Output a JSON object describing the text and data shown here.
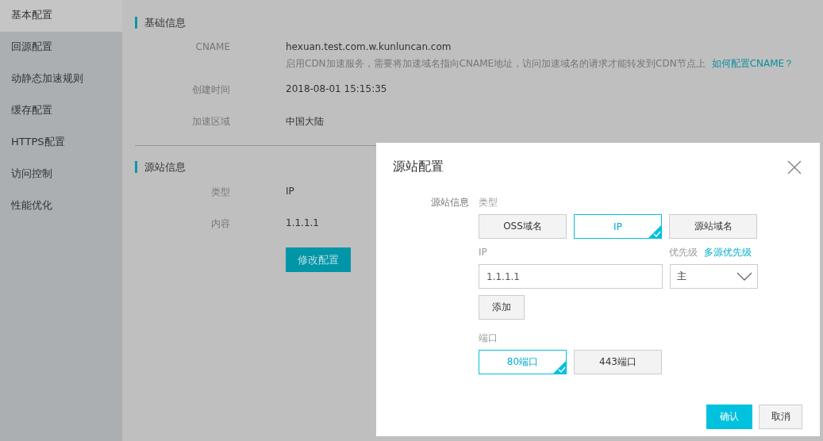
{
  "sidebar": {
    "items": [
      {
        "label": "基本配置",
        "selected": true
      },
      {
        "label": "回源配置",
        "selected": false
      },
      {
        "label": "动静态加速规则",
        "selected": false
      },
      {
        "label": "缓存配置",
        "selected": false
      },
      {
        "label": "HTTPS配置",
        "selected": false
      },
      {
        "label": "访问控制",
        "selected": false
      },
      {
        "label": "性能优化",
        "selected": false
      }
    ]
  },
  "basic_info": {
    "title": "基础信息",
    "fields": [
      {
        "label": "CNAME",
        "value": "hexuan.test.com.w.kunluncan.com",
        "hint": "启用CDN加速服务，需要将加速域名指向CNAME地址，访问加速域名的请求才能转发到CDN节点上",
        "link": "如何配置CNAME？"
      },
      {
        "label": "创建时间",
        "value": "2018-08-01 15:15:35"
      },
      {
        "label": "加速区域",
        "value": "中国大陆"
      }
    ]
  },
  "origin_info": {
    "title": "源站信息",
    "fields": [
      {
        "label": "类型",
        "value": "IP"
      },
      {
        "label": "内容",
        "value": "1.1.1.1"
      }
    ],
    "button": "修改配置"
  },
  "dialog": {
    "title": "源站配置",
    "origin_label": "源站信息",
    "type_label": "类型",
    "types": [
      {
        "label": "OSS域名",
        "selected": false
      },
      {
        "label": "IP",
        "selected": true
      },
      {
        "label": "源站域名",
        "selected": false
      }
    ],
    "ip_label": "IP",
    "priority_label": "优先级",
    "priority_link": "多源优先级",
    "ip_value": "1.1.1.1",
    "priority_value": "主",
    "add_button": "添加",
    "port_label": "端口",
    "ports": [
      {
        "label": "80端口",
        "selected": true
      },
      {
        "label": "443端口",
        "selected": false
      }
    ],
    "confirm": "确认",
    "cancel": "取消"
  }
}
